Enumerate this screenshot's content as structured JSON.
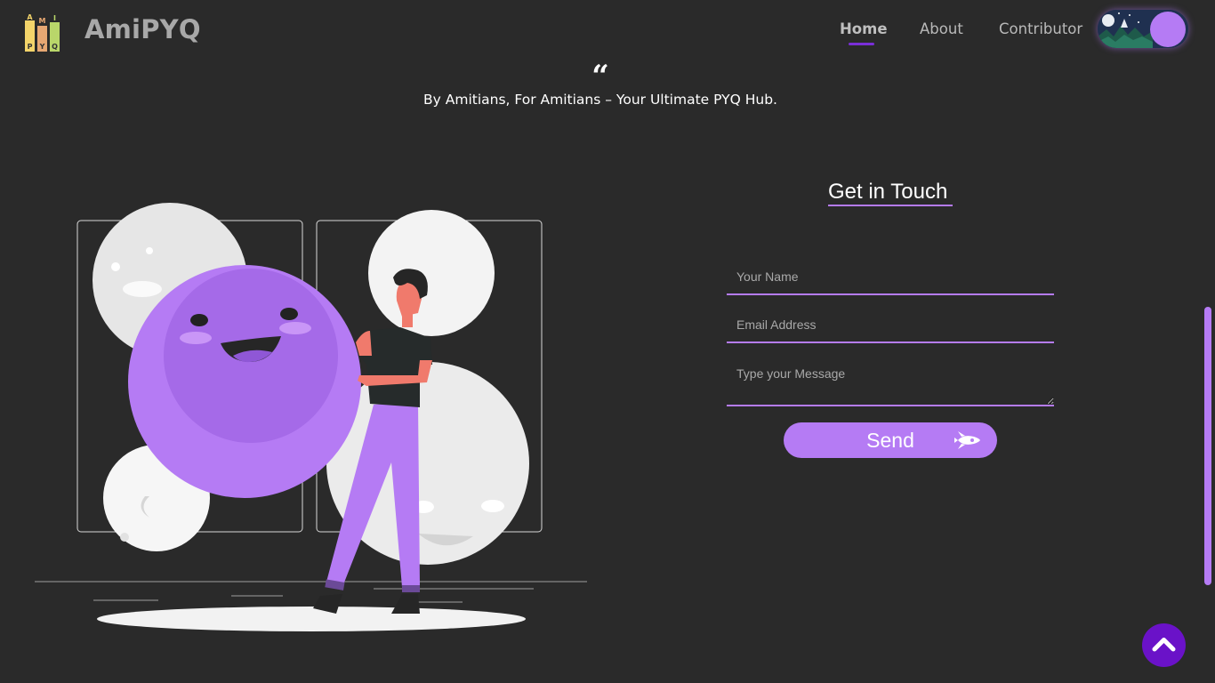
{
  "header": {
    "logo_letters": [
      "A",
      "M",
      "I",
      "P",
      "Y",
      "Q"
    ],
    "brand": "AmiPYQ",
    "nav": [
      {
        "label": "Home",
        "active": true
      },
      {
        "label": "About",
        "active": false
      },
      {
        "label": "Contributor",
        "active": false
      }
    ],
    "theme_toggle_icon": "moon-night-scene-icon"
  },
  "hero": {
    "quote_mark": "“",
    "tagline": "By Amitians, For Amitians – Your Ultimate PYQ Hub."
  },
  "illustration": {
    "icon": "person-with-bubbles-illustration"
  },
  "contact": {
    "title": "Get in Touch",
    "name_placeholder": "Your Name",
    "email_placeholder": "Email Address",
    "message_placeholder": "Type your Message",
    "send_label": "Send",
    "send_icon": "rocket-icon"
  },
  "scroll_top_icon": "chevron-up-icon",
  "colors": {
    "background": "#2a2a2a",
    "accent": "#b57bf4",
    "accent_dark": "#6a12c8",
    "active_underline": "#7a2fd8"
  }
}
